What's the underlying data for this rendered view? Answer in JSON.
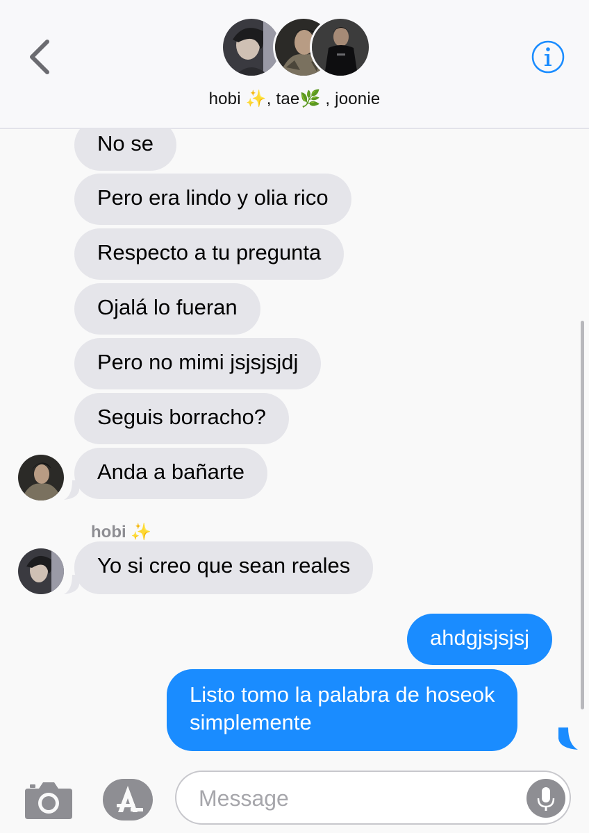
{
  "header": {
    "title_parts": [
      {
        "name": "hobi",
        "emoji": "✨",
        "sep": ", "
      },
      {
        "name": "tae",
        "emoji": "🌿",
        "sep": " , "
      },
      {
        "name": "joonie",
        "emoji": "",
        "sep": ""
      }
    ],
    "title_name_1": "hobi",
    "title_emoji_1": "✨",
    "title_name_2": "tae",
    "title_emoji_2": "🌿",
    "title_name_3": "joonie",
    "back_icon": "chevron-left-icon",
    "info_icon": "info-icon"
  },
  "messages": {
    "incoming_group_1": [
      "No se",
      "Pero era lindo y olia rico",
      "Respecto a tu pregunta",
      "Ojalá lo fueran",
      "Pero no mimi jsjsjsjdj",
      "Seguis borracho?",
      "Anda a bañarte"
    ],
    "sender_2_name": "hobi",
    "sender_2_emoji": "✨",
    "incoming_group_2": [
      "Yo si creo que sean reales"
    ],
    "outgoing": [
      "ahdgjsjsjsj",
      "Listo tomo la palabra de hoseok simplemente"
    ],
    "outgoing_line_1": "Listo tomo la palabra de hoseok",
    "outgoing_line_2": "simplemente"
  },
  "input": {
    "placeholder": "Message",
    "camera_icon": "camera-icon",
    "apps_icon": "app-store-icon",
    "mic_icon": "microphone-icon"
  },
  "colors": {
    "outgoing_bubble": "#1a8cff",
    "incoming_bubble": "#e5e5ea",
    "accent": "#1a8cff",
    "background": "#f9f9f9"
  }
}
